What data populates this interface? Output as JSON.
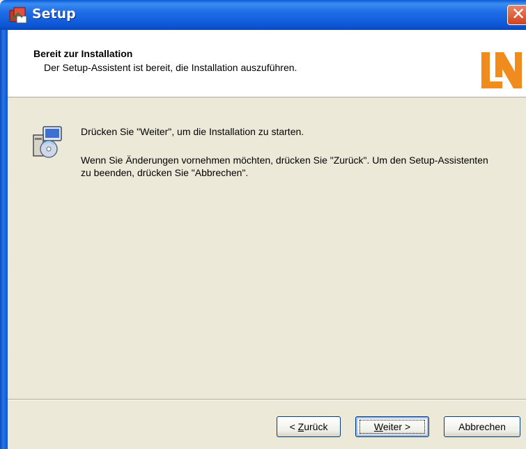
{
  "window": {
    "title": "Setup"
  },
  "header": {
    "title": "Bereit zur Installation",
    "subtitle": "Der Setup-Assistent ist bereit, die Installation auszuführen.",
    "logo_text": "LN"
  },
  "content": {
    "line1": "Drücken Sie \"Weiter\", um die Installation zu starten.",
    "line2": "Wenn Sie Änderungen vornehmen möchten, drücken Sie \"Zurück\". Um den Setup-Assistenten zu beenden, drücken Sie \"Abbrechen\"."
  },
  "buttons": {
    "back_prefix": "< ",
    "back_mnemonic": "Z",
    "back_rest": "urück",
    "next_mnemonic": "W",
    "next_rest": "eiter >",
    "cancel": "Abbrechen"
  },
  "colors": {
    "titlebar": "#0c56d6",
    "logo_orange": "#f08c1e",
    "dialog_bg": "#ece9d8"
  }
}
